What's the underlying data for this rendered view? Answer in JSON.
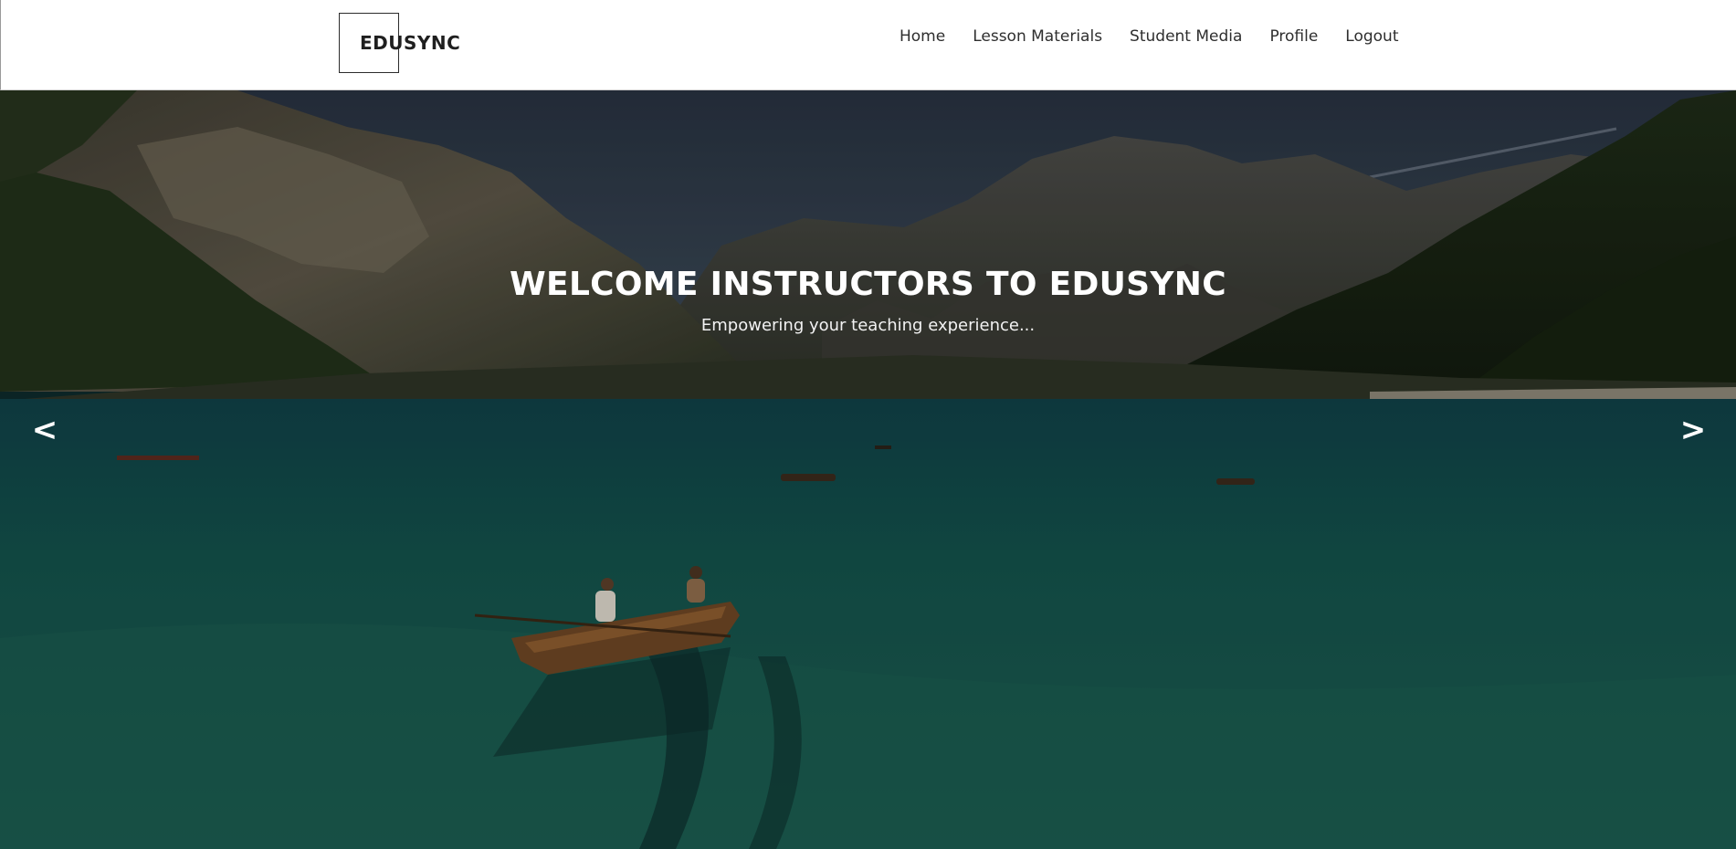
{
  "brand": {
    "logo_text": "EDUSYNC"
  },
  "nav": {
    "items": [
      {
        "label": "Home"
      },
      {
        "label": "Lesson Materials"
      },
      {
        "label": "Student Media"
      },
      {
        "label": "Profile"
      },
      {
        "label": "Logout"
      }
    ]
  },
  "hero": {
    "title": "WELCOME INSTRUCTORS TO EDUSYNC",
    "subtitle": "Empowering your teaching experience...",
    "prev_arrow": "<",
    "next_arrow": ">",
    "image_subject": "mountain lake with rowing boats"
  },
  "colors": {
    "header_bg": "#ffffff",
    "nav_text": "#2e2e2e",
    "hero_text": "#ffffff",
    "water": "#14524f",
    "sky": "#2f3b4c"
  }
}
